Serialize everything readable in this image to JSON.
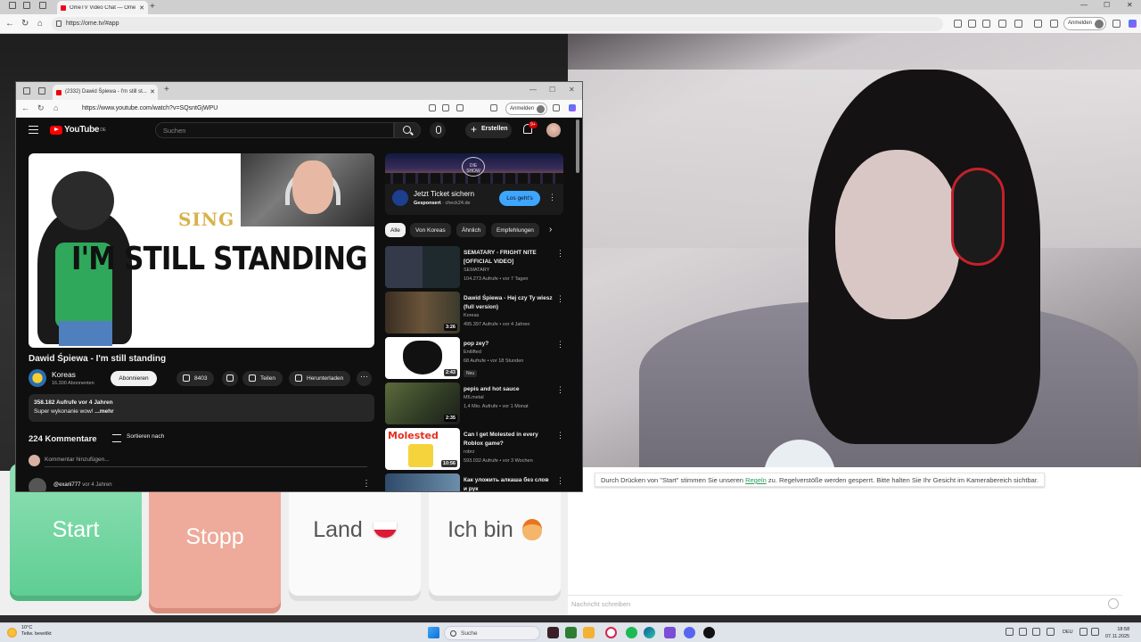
{
  "outer_browser": {
    "tab_title": "OmeTV Video Chat — Ome",
    "url": "https://ome.tv/#app",
    "signin_label": "Anmelden"
  },
  "ome": {
    "buttons": {
      "start": "Start",
      "stop": "Stopp",
      "country": "Land",
      "me": "Ich bin"
    },
    "notice": {
      "before": "Durch Drücken von \"Start\" stimmen Sie unseren ",
      "link": "Regeln",
      "after": " zu. Regelverstöße werden gesperrt. Bitte halten Sie Ihr Gesicht im Kamerabereich sichtbar."
    },
    "chat_placeholder": "Nachricht schreiben"
  },
  "inner_browser": {
    "tab_title": "(2332) Dawid Śpiewa - I'm still st...",
    "url": "https://www.youtube.com/watch?v=SQsntGjWPU",
    "signin_label": "Anmelden"
  },
  "youtube": {
    "logo": "YouTube",
    "region": "DE",
    "search_placeholder": "Suchen",
    "create_label": "Erstellen",
    "notif_count": "9+",
    "video": {
      "thumb_word": "SING",
      "thumb_title": "I'M STILL STANDING",
      "title": "Dawid Śpiewa - I'm still standing",
      "channel": "Koreas",
      "subscribers": "16.300 Abonnenten",
      "subscribe": "Abonnieren",
      "likes": "8403",
      "share": "Teilen",
      "download": "Herunterladen",
      "views_line": "358.182 Aufrufe  vor 4 Jahren",
      "description": "Super wykonanie wow! ",
      "more": "...mehr"
    },
    "comments": {
      "count": "224 Kommentare",
      "sort": "Sortieren nach",
      "placeholder": "Kommentar hinzufügen...",
      "first_user": "@exarii777",
      "first_time": "vor 4 Jahren"
    },
    "ad": {
      "banner_logo": "DIE SHOW",
      "title": "Jetzt Ticket sichern",
      "sponsored": "Gesponsert",
      "advertiser": "check24.de",
      "cta": "Los geht's"
    },
    "chips": [
      "Alle",
      "Von Koreas",
      "Ähnlich",
      "Empfehlungen"
    ],
    "recommendations": [
      {
        "title": "SEMATARY - FRIGHT NITE [OFFICIAL VIDEO]",
        "channel": "SEMATARY",
        "meta": "104.273 Aufrufe • vor 7 Tagen",
        "duration": ""
      },
      {
        "title": "Dawid Śpiewa -  Hej czy Ty wiesz (full version)",
        "channel": "Koreas",
        "meta": "495.397 Aufrufe • vor 4 Jahren",
        "duration": "3:26"
      },
      {
        "title": "pop zey?",
        "channel": "Entlifted",
        "meta": "68 Aufrufe • vor 18 Stunden",
        "duration": "2:43",
        "badge": "Neu"
      },
      {
        "title": "pepis and hot sauce",
        "channel": "M6.metal",
        "meta": "1,4 Mio. Aufrufe • vor 1 Monat",
        "duration": "2:35"
      },
      {
        "title": "Can I get Molested in every Roblox game?",
        "channel": "robrz",
        "meta": "593.032 Aufrufe • vor 3 Wochen",
        "duration": "10:56",
        "thumb_text": "Molested"
      },
      {
        "title": "Как уложить алкаша без слов и рук",
        "channel": "",
        "meta": "",
        "duration": ""
      }
    ]
  },
  "taskbar": {
    "weather_temp": "10°C",
    "weather_desc": "Teilw. bewölkt",
    "search": "Suche",
    "lang": "DEU",
    "time": "18:58",
    "date": "07.11.2025"
  },
  "colors": {
    "start": "#5fce94",
    "stop": "#eeaa9a",
    "yt_bg": "#0f0f0f",
    "yt_red": "#ff0000",
    "cta_blue": "#3ea6ff"
  }
}
